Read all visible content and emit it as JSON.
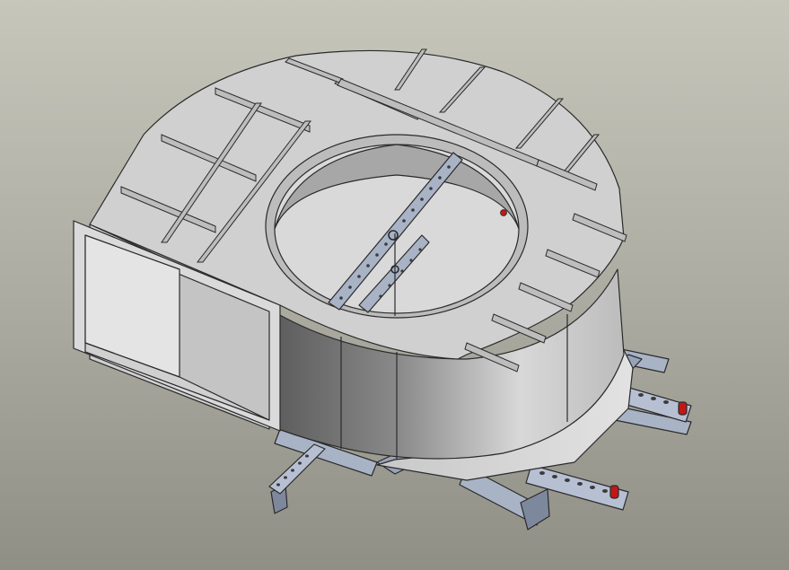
{
  "viewport": {
    "background_top": "#c6c6bb",
    "background_bottom": "#8f8f86"
  },
  "colors": {
    "sheet_metal_light": "#d2d2d2",
    "sheet_metal_mid": "#bdbdbd",
    "sheet_metal_dark": "#6f6f6f",
    "steel_frame": "#a9b3c6",
    "steel_frame_dark": "#7e889c",
    "edge": "#2a2a2a",
    "bolt_red": "#c01818"
  },
  "model": {
    "parts": [
      "hood-top-plate",
      "circular-opening",
      "stiffener-ribs",
      "rectangular-inlet-duct",
      "cylindrical-shell",
      "center-hanger-bar",
      "support-frame",
      "slotted-rails",
      "red-bolts"
    ]
  }
}
